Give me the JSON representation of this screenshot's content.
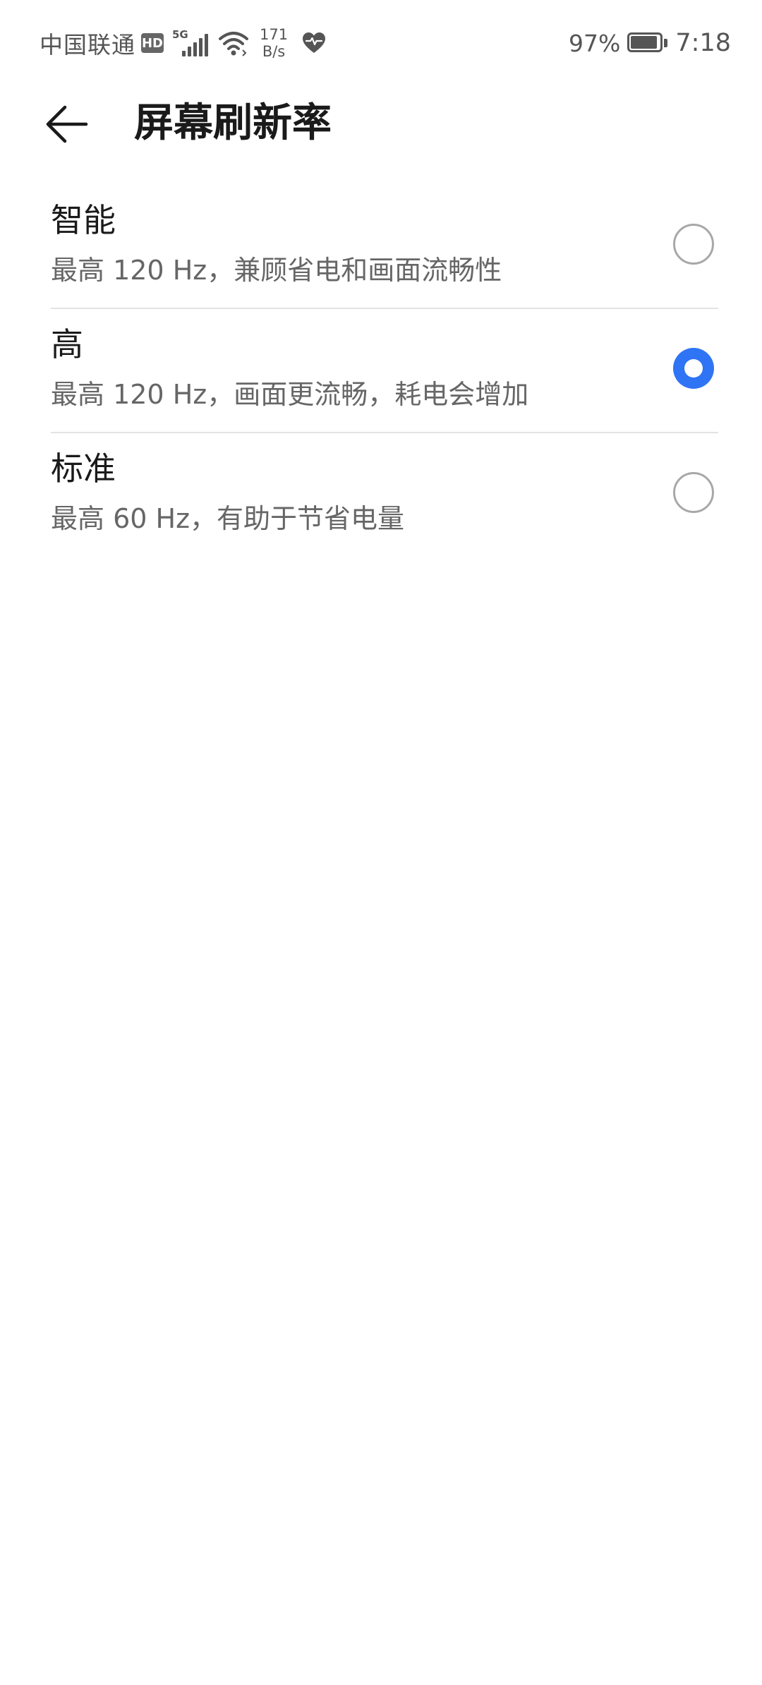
{
  "status_bar": {
    "carrier": "中国联通",
    "hd_badge": "HD",
    "network_type": "5G",
    "signal_bars": 5,
    "net_speed_value": "171",
    "net_speed_unit": "B/s",
    "battery_percent": "97%",
    "battery_level": 0.97,
    "time": "7:18",
    "icons": [
      "hd-icon",
      "signal-5g-icon",
      "wifi-icon",
      "health-heart-icon",
      "battery-icon"
    ]
  },
  "header": {
    "back_icon": "arrow-left-icon",
    "title": "屏幕刷新率"
  },
  "options": [
    {
      "title": "智能",
      "description": "最高 120 Hz，兼顾省电和画面流畅性",
      "selected": false
    },
    {
      "title": "高",
      "description": "最高 120 Hz，画面更流畅，耗电会增加",
      "selected": true
    },
    {
      "title": "标准",
      "description": "最高 60 Hz，有助于节省电量",
      "selected": false
    }
  ],
  "colors": {
    "accent": "#2f74f5",
    "radio_unchecked_border": "#a8a8a8",
    "divider": "#e3e3e3",
    "primary_text": "#1a1a1a",
    "secondary_text": "#666666"
  }
}
